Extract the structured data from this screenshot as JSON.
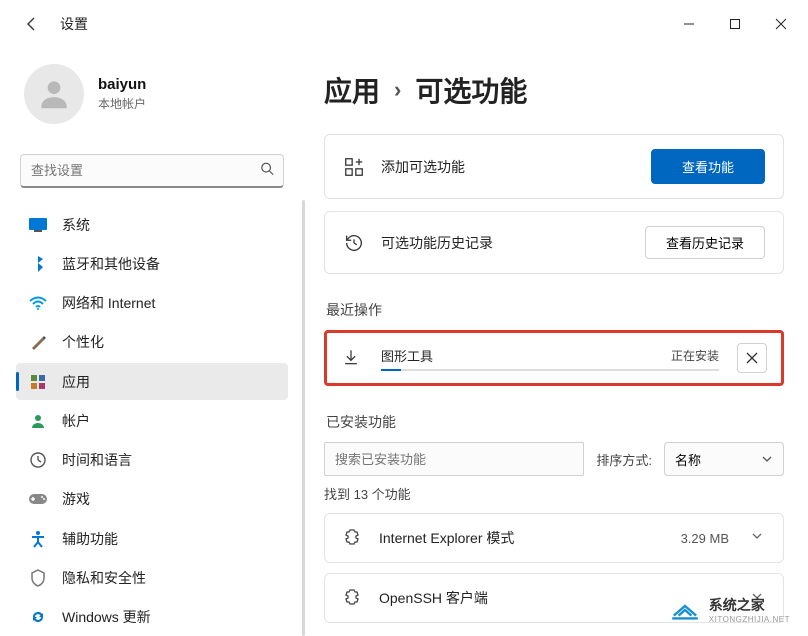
{
  "app_title": "设置",
  "user": {
    "name": "baiyun",
    "sub": "本地帐户"
  },
  "search_placeholder": "查找设置",
  "nav": {
    "items": [
      {
        "key": "system",
        "label": "系统"
      },
      {
        "key": "bluetooth",
        "label": "蓝牙和其他设备"
      },
      {
        "key": "network",
        "label": "网络和 Internet"
      },
      {
        "key": "personalization",
        "label": "个性化"
      },
      {
        "key": "apps",
        "label": "应用",
        "selected": true
      },
      {
        "key": "accounts",
        "label": "帐户"
      },
      {
        "key": "time",
        "label": "时间和语言"
      },
      {
        "key": "gaming",
        "label": "游戏"
      },
      {
        "key": "accessibility",
        "label": "辅助功能"
      },
      {
        "key": "privacy",
        "label": "隐私和安全性"
      },
      {
        "key": "update",
        "label": "Windows 更新"
      }
    ]
  },
  "breadcrumb": {
    "parent": "应用",
    "current": "可选功能"
  },
  "cards": {
    "add": {
      "label": "添加可选功能",
      "button": "查看功能"
    },
    "history": {
      "label": "可选功能历史记录",
      "button": "查看历史记录"
    }
  },
  "sections": {
    "recent": "最近操作",
    "installed": "已安装功能"
  },
  "recent": {
    "name": "图形工具",
    "status": "正在安装"
  },
  "installed_search_placeholder": "搜索已安装功能",
  "sort": {
    "label": "排序方式:",
    "value": "名称"
  },
  "found_text": "找到 13 个功能",
  "features": [
    {
      "name": "Internet Explorer 模式",
      "size": "3.29 MB"
    },
    {
      "name": "OpenSSH 客户端",
      "size": ""
    }
  ],
  "watermark": {
    "title": "系统之家",
    "sub": "XITONGZHIJIA.NET"
  },
  "watermark_size_overlay": "3.29 MB"
}
